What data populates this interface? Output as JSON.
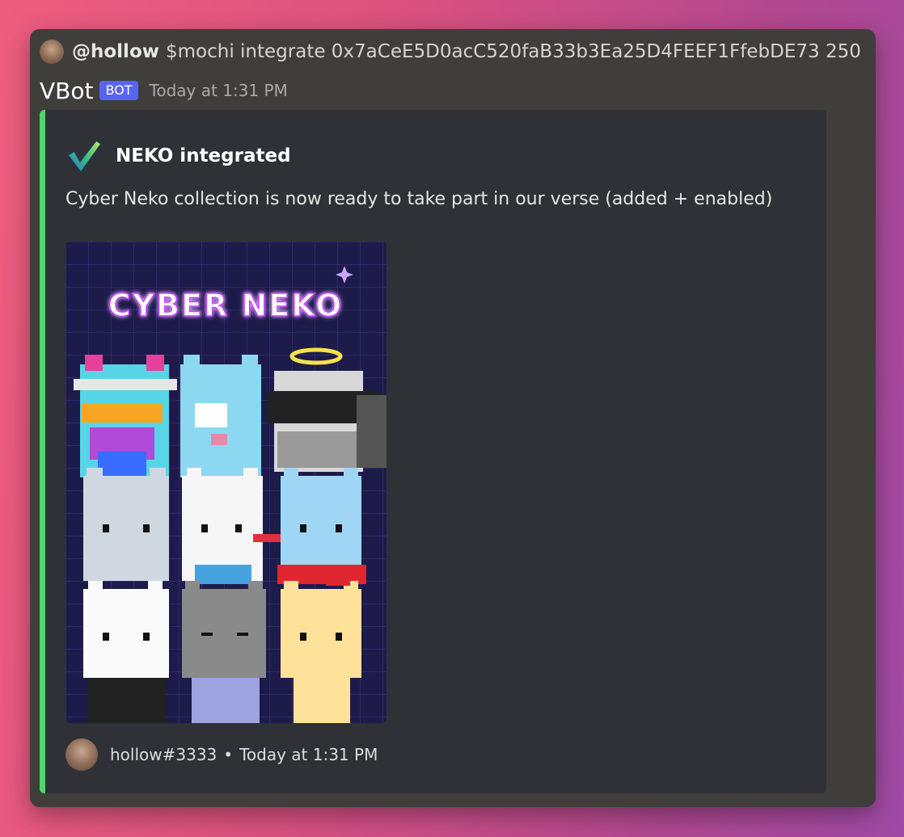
{
  "reply": {
    "username": "@hollow",
    "command": "$mochi integrate 0x7aCeE5D0acC520faB33b3Ea25D4FEEF1FfebDE73 250"
  },
  "message": {
    "author": "VBot",
    "badge": "BOT",
    "timestamp": "Today at 1:31 PM"
  },
  "embed": {
    "accent_color": "#53d36a",
    "title_icon": "check-mark-icon",
    "title": "NEKO integrated",
    "description": "Cyber Neko collection is now ready to take part in our verse (added + enabled)",
    "image_title": "CYBER NEKO",
    "footer": {
      "user": "hollow#3333",
      "separator": "•",
      "time": "Today at 1:31 PM"
    }
  },
  "colors": {
    "badge": "#5865f2",
    "embed_bg": "#2f3136",
    "window_bg": "#3f3e3a"
  }
}
